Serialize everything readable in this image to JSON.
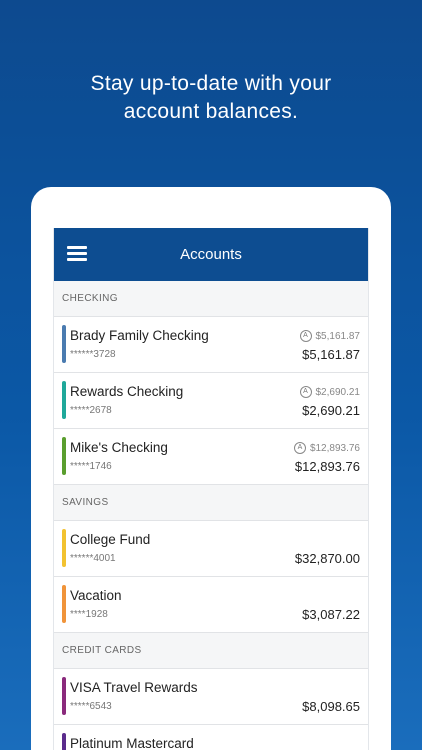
{
  "promo": {
    "line1": "Stay up-to-date with your",
    "line2": "account balances."
  },
  "appbar": {
    "title": "Accounts"
  },
  "sections": [
    {
      "header": "CHECKING",
      "accounts": [
        {
          "name": "Brady Family Checking",
          "number": "******3728",
          "available": "$5,161.87",
          "balance": "$5,161.87",
          "color": "#4a7bb0"
        },
        {
          "name": "Rewards Checking",
          "number": "*****2678",
          "available": "$2,690.21",
          "balance": "$2,690.21",
          "color": "#1fa89a"
        },
        {
          "name": "Mike's Checking",
          "number": "*****1746",
          "available": "$12,893.76",
          "balance": "$12,893.76",
          "color": "#5a9e2e"
        }
      ]
    },
    {
      "header": "SAVINGS",
      "accounts": [
        {
          "name": "College Fund",
          "number": "******4001",
          "balance": "$32,870.00",
          "color": "#f2c230"
        },
        {
          "name": "Vacation",
          "number": "****1928",
          "balance": "$3,087.22",
          "color": "#f0943a"
        }
      ]
    },
    {
      "header": "CREDIT CARDS",
      "accounts": [
        {
          "name": "VISA Travel Rewards",
          "number": "*****6543",
          "balance": "$8,098.65",
          "color": "#8a2a7c"
        },
        {
          "name": "Platinum Mastercard",
          "color": "#5b2b8c"
        }
      ]
    }
  ],
  "icons": {
    "available_balance": "A"
  }
}
